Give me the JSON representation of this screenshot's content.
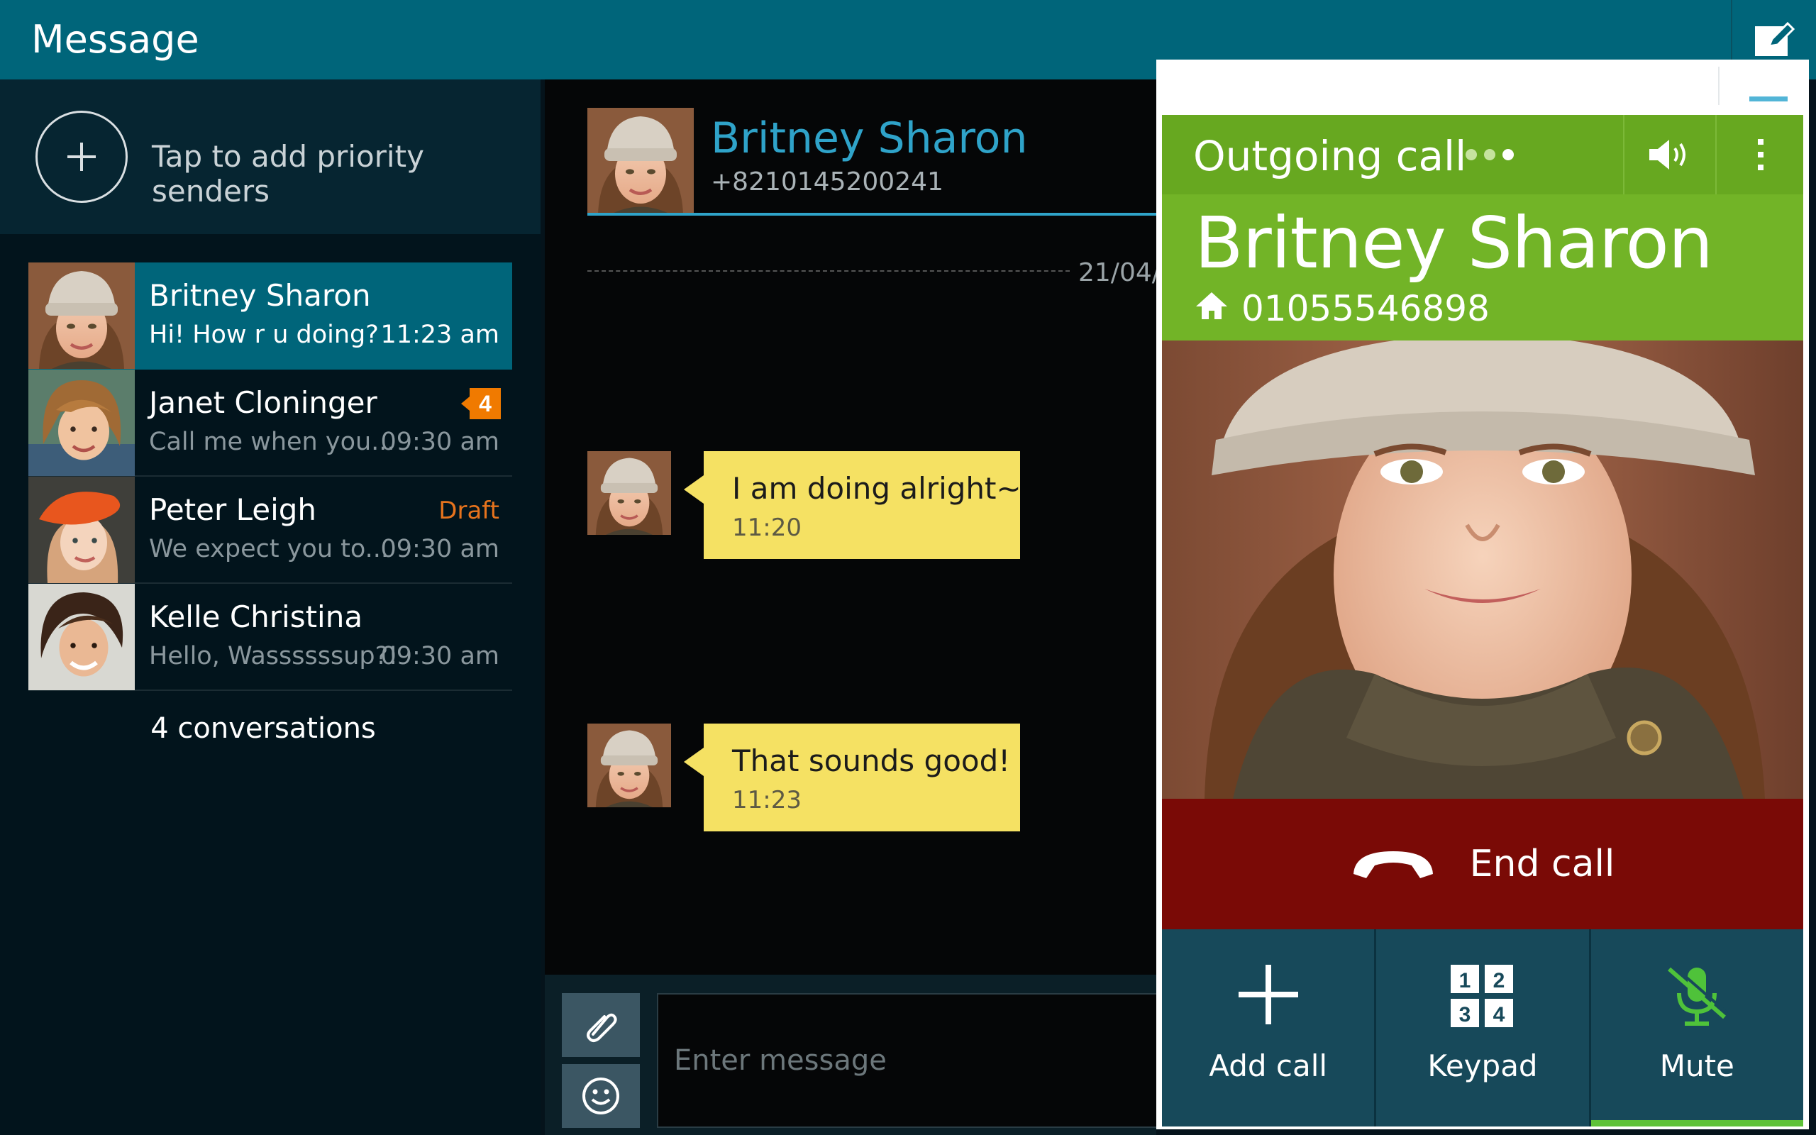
{
  "header": {
    "title": "Message"
  },
  "priority": {
    "label": "Tap to add priority senders"
  },
  "conversations": [
    {
      "name": "Britney Sharon",
      "preview": "Hi! How r u doing?",
      "time": "11:23 am",
      "selected": true
    },
    {
      "name": "Janet Cloninger",
      "preview": "Call me when you...",
      "time": "09:30 am",
      "badge": "4"
    },
    {
      "name": "Peter Leigh",
      "preview": "We expect you to...",
      "time": "09:30 am",
      "status": "Draft"
    },
    {
      "name": "Kelle Christina",
      "preview": "Hello, Wassssssup?!",
      "time": "09:30 am"
    }
  ],
  "conversation_count": "4 conversations",
  "chat": {
    "contact_name": "Britney Sharon",
    "contact_number": "+8210145200241",
    "date_label": "21/04/",
    "messages": [
      {
        "text": "I am doing alright~",
        "time": "11:20"
      },
      {
        "text": "That sounds good!",
        "time": "11:23"
      }
    ],
    "input_placeholder": "Enter message"
  },
  "call": {
    "status": "Outgoing call",
    "caller_name": "Britney Sharon",
    "caller_number": "01055546898",
    "end_call_label": "End call",
    "actions": [
      {
        "label": "Add call",
        "icon": "plus-icon"
      },
      {
        "label": "Keypad",
        "icon": "keypad-icon",
        "digits": [
          "1",
          "2",
          "3",
          "4"
        ]
      },
      {
        "label": "Mute",
        "icon": "mic-off-icon",
        "active": true
      }
    ]
  },
  "colors": {
    "header": "#00657a",
    "call_green": "#72b427",
    "end_call_red": "#7a0a06",
    "bubble_yellow": "#f5e163",
    "accent_blue": "#2fa3c9",
    "badge_orange": "#f07a00"
  }
}
